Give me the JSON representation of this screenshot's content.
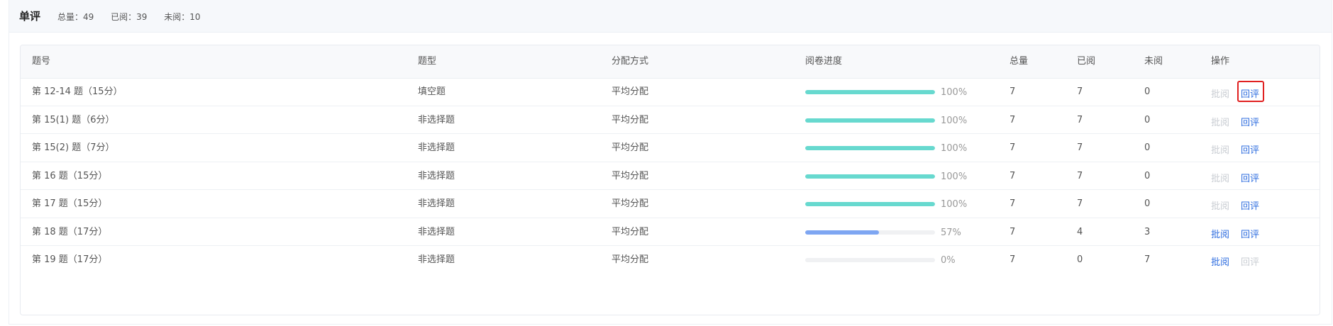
{
  "header": {
    "title": "单评",
    "total": "总量：49",
    "read": "已阅：39",
    "unread": "未阅：10"
  },
  "colors": {
    "progress_complete": "#67d9cf",
    "progress_partial": "#7ea6f2",
    "link_active": "#2d6cdf",
    "link_disabled": "#c8ccd2",
    "highlight_border": "#e02020"
  },
  "table": {
    "columns": [
      "题号",
      "题型",
      "分配方式",
      "阅卷进度",
      "总量",
      "已阅",
      "未阅",
      "操作"
    ],
    "rows": [
      {
        "num": "第 12-14 题（15分）",
        "type": "填空题",
        "dist": "平均分配",
        "progress": 1.0,
        "pct": "100%",
        "total": "7",
        "read": "7",
        "unread": "0",
        "op1": "批阅",
        "op1_enabled": false,
        "op2": "回评",
        "op2_enabled": true,
        "op2_highlighted": true
      },
      {
        "num": "第 15(1) 题（6分）",
        "type": "非选择题",
        "dist": "平均分配",
        "progress": 1.0,
        "pct": "100%",
        "total": "7",
        "read": "7",
        "unread": "0",
        "op1": "批阅",
        "op1_enabled": false,
        "op2": "回评",
        "op2_enabled": true
      },
      {
        "num": "第 15(2) 题（7分）",
        "type": "非选择题",
        "dist": "平均分配",
        "progress": 1.0,
        "pct": "100%",
        "total": "7",
        "read": "7",
        "unread": "0",
        "op1": "批阅",
        "op1_enabled": false,
        "op2": "回评",
        "op2_enabled": true
      },
      {
        "num": "第 16 题（15分）",
        "type": "非选择题",
        "dist": "平均分配",
        "progress": 1.0,
        "pct": "100%",
        "total": "7",
        "read": "7",
        "unread": "0",
        "op1": "批阅",
        "op1_enabled": false,
        "op2": "回评",
        "op2_enabled": true
      },
      {
        "num": "第 17 题（15分）",
        "type": "非选择题",
        "dist": "平均分配",
        "progress": 1.0,
        "pct": "100%",
        "total": "7",
        "read": "7",
        "unread": "0",
        "op1": "批阅",
        "op1_enabled": false,
        "op2": "回评",
        "op2_enabled": true
      },
      {
        "num": "第 18 题（17分）",
        "type": "非选择题",
        "dist": "平均分配",
        "progress": 0.57,
        "pct": "57%",
        "total": "7",
        "read": "4",
        "unread": "3",
        "op1": "批阅",
        "op1_enabled": true,
        "op2": "回评",
        "op2_enabled": true
      },
      {
        "num": "第 19 题（17分）",
        "type": "非选择题",
        "dist": "平均分配",
        "progress": 0.0,
        "pct": "0%",
        "total": "7",
        "read": "0",
        "unread": "7",
        "op1": "批阅",
        "op1_enabled": true,
        "op2": "回评",
        "op2_enabled": false
      }
    ]
  }
}
